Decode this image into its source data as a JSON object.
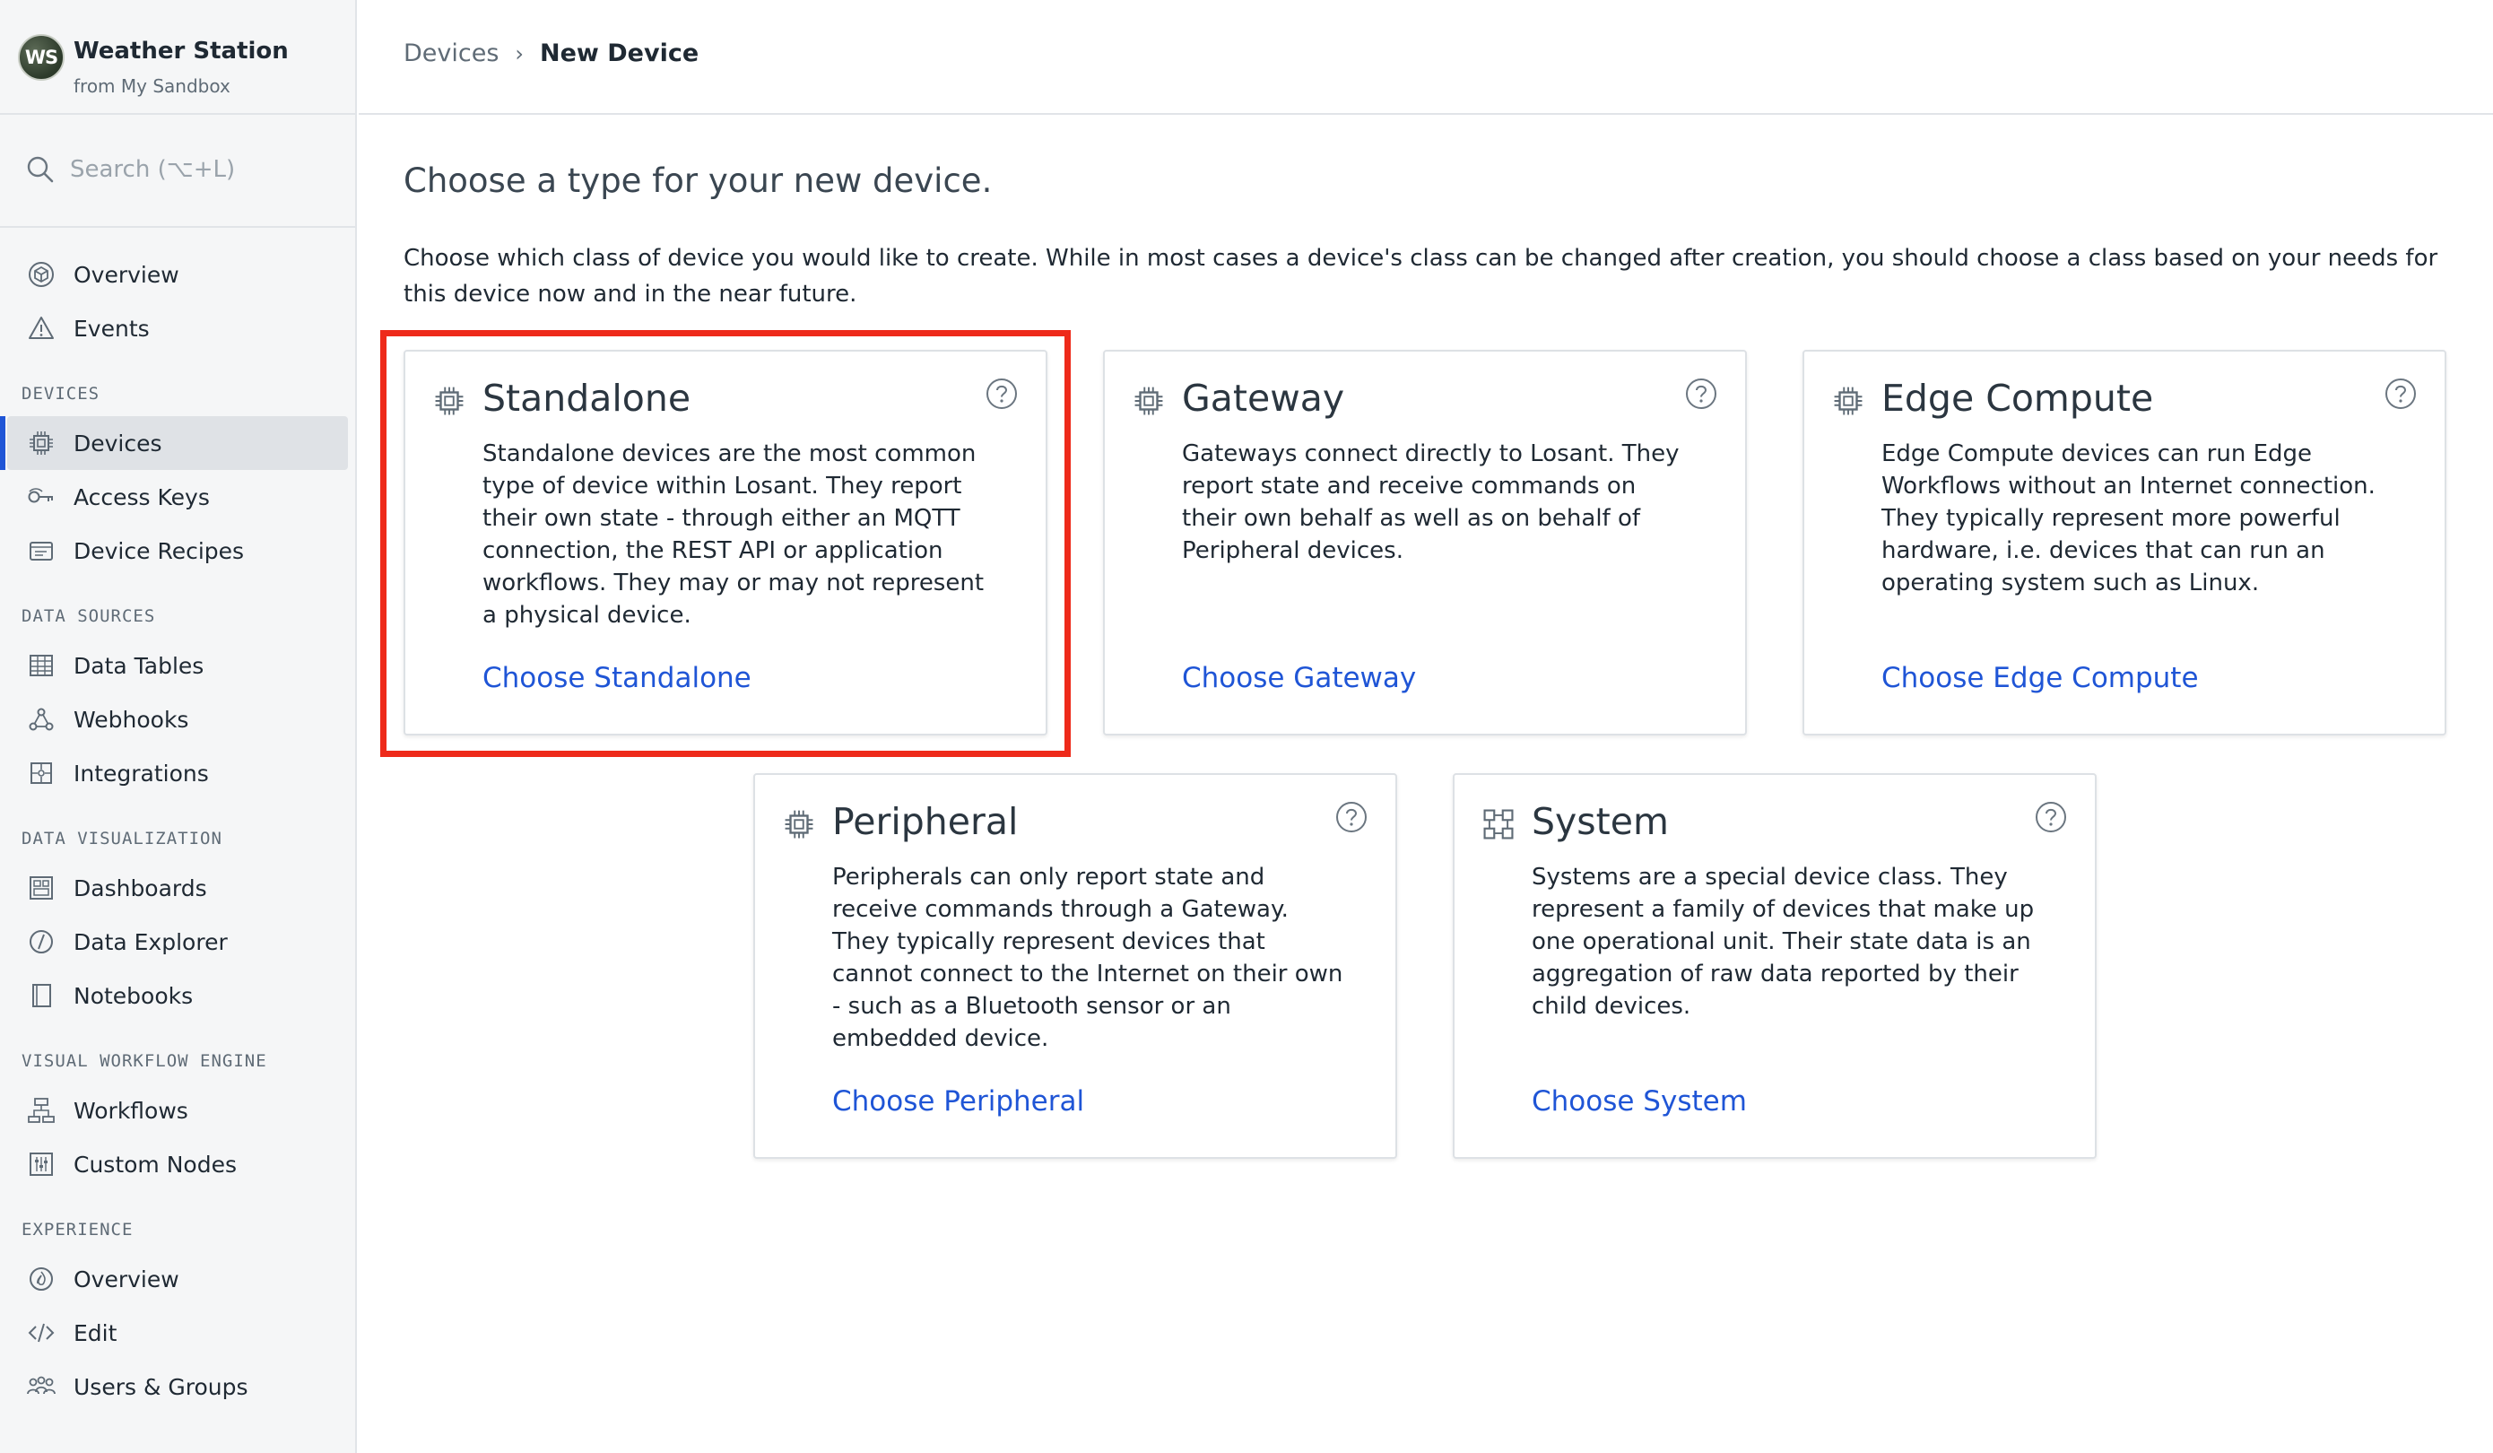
{
  "app": {
    "avatar_initials": "WS",
    "title": "Weather Station",
    "subtitle": "from My Sandbox"
  },
  "search": {
    "placeholder": "Search (⌥+L)"
  },
  "nav": {
    "top": [
      {
        "label": "Overview",
        "icon": "cube-icon"
      },
      {
        "label": "Events",
        "icon": "warning-icon"
      }
    ],
    "sections": [
      {
        "title": "DEVICES",
        "items": [
          {
            "label": "Devices",
            "icon": "chip-icon",
            "active": true
          },
          {
            "label": "Access Keys",
            "icon": "key-icon"
          },
          {
            "label": "Device Recipes",
            "icon": "recipe-icon"
          }
        ]
      },
      {
        "title": "DATA SOURCES",
        "items": [
          {
            "label": "Data Tables",
            "icon": "table-icon"
          },
          {
            "label": "Webhooks",
            "icon": "webhook-icon"
          },
          {
            "label": "Integrations",
            "icon": "puzzle-icon"
          }
        ]
      },
      {
        "title": "DATA VISUALIZATION",
        "items": [
          {
            "label": "Dashboards",
            "icon": "dashboard-icon"
          },
          {
            "label": "Data Explorer",
            "icon": "compass-icon"
          },
          {
            "label": "Notebooks",
            "icon": "notebook-icon"
          }
        ]
      },
      {
        "title": "VISUAL WORKFLOW ENGINE",
        "items": [
          {
            "label": "Workflows",
            "icon": "workflow-icon"
          },
          {
            "label": "Custom Nodes",
            "icon": "sliders-icon"
          }
        ]
      },
      {
        "title": "EXPERIENCE",
        "items": [
          {
            "label": "Overview",
            "icon": "flame-icon"
          },
          {
            "label": "Edit",
            "icon": "code-icon"
          },
          {
            "label": "Users & Groups",
            "icon": "users-icon"
          }
        ]
      }
    ]
  },
  "breadcrumb": {
    "parent": "Devices",
    "separator": "›",
    "current": "New Device"
  },
  "page": {
    "title": "Choose a type for your new device.",
    "description": "Choose which class of device you would like to create. While in most cases a device's class can be changed after creation, you should choose a class based on your needs for this device now and in the near future."
  },
  "cards": [
    {
      "id": "standalone",
      "title": "Standalone",
      "description": "Standalone devices are the most common type of device within Losant. They report their own state - through either an MQTT connection, the REST API or application workflows. They may or may not represent a physical device.",
      "link": "Choose Standalone",
      "icon": "chip-icon",
      "highlighted": true
    },
    {
      "id": "gateway",
      "title": "Gateway",
      "description": "Gateways connect directly to Losant. They report state and receive commands on their own behalf as well as on behalf of Peripheral devices.",
      "link": "Choose Gateway",
      "icon": "chip-icon"
    },
    {
      "id": "edge-compute",
      "title": "Edge Compute",
      "description": "Edge Compute devices can run Edge Workflows without an Internet connection. They typically represent more powerful hardware, i.e. devices that can run an operating system such as Linux.",
      "link": "Choose Edge Compute",
      "icon": "chip-icon"
    },
    {
      "id": "peripheral",
      "title": "Peripheral",
      "description": "Peripherals can only report state and receive commands through a Gateway. They typically represent devices that cannot connect to the Internet on their own - such as a Bluetooth sensor or an embedded device.",
      "link": "Choose Peripheral",
      "icon": "chip-icon"
    },
    {
      "id": "system",
      "title": "System",
      "description": "Systems are a special device class. They represent a family of devices that make up one operational unit. Their state data is an aggregation of raw data reported by their child devices.",
      "link": "Choose System",
      "icon": "system-icon"
    }
  ],
  "colors": {
    "accent": "#1f55d6",
    "highlight": "#ee2a1a",
    "sidebar_bg": "#f5f6f7"
  }
}
